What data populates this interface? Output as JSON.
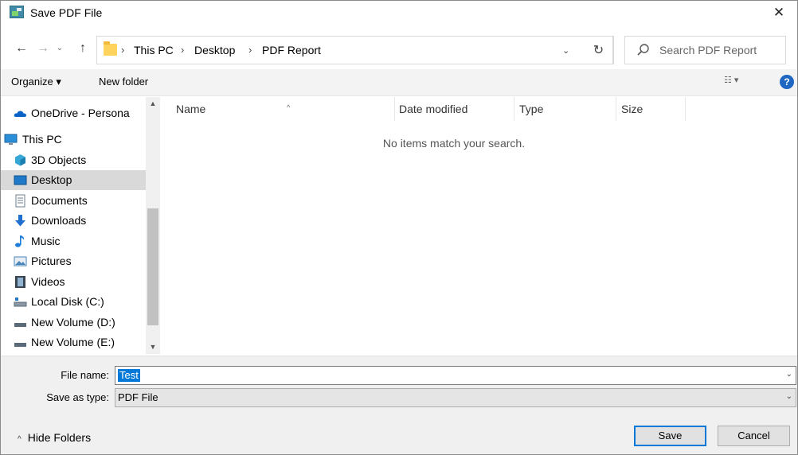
{
  "window": {
    "title": "Save PDF File",
    "close_glyph": "✕"
  },
  "nav": {
    "back_glyph": "←",
    "forward_glyph": "→",
    "recent_glyph": "⌄",
    "up_glyph": "↑"
  },
  "address": {
    "breadcrumbs": [
      "This PC",
      "Desktop",
      "PDF Report"
    ],
    "separator": "›",
    "dropdown_glyph": "⌄",
    "refresh_glyph": "↻"
  },
  "search": {
    "placeholder": "Search PDF Report"
  },
  "toolbar": {
    "organize_label": "Organize ▾",
    "new_folder_label": "New folder",
    "view_glyph": "☷ ▾",
    "help_glyph": "?"
  },
  "sidebar": {
    "items": [
      {
        "label": "OneDrive - Persona",
        "icon": "onedrive-cloud-icon",
        "color": "#0a64c8"
      },
      {
        "label": "This PC",
        "icon": "computer-icon",
        "color": "#2a8fd8"
      },
      {
        "label": "3D Objects",
        "icon": "cube-icon",
        "color": "#36a7d6"
      },
      {
        "label": "Desktop",
        "icon": "desktop-icon",
        "color": "#1e79c8"
      },
      {
        "label": "Documents",
        "icon": "document-icon",
        "color": "#6d7c8c"
      },
      {
        "label": "Downloads",
        "icon": "download-arrow-icon",
        "color": "#1e6fd0"
      },
      {
        "label": "Music",
        "icon": "music-note-icon",
        "color": "#1e7dd9"
      },
      {
        "label": "Pictures",
        "icon": "picture-icon",
        "color": "#4a86b8"
      },
      {
        "label": "Videos",
        "icon": "film-icon",
        "color": "#3a4652"
      },
      {
        "label": "Local Disk (C:)",
        "icon": "drive-icon",
        "color": "#5a6a78"
      },
      {
        "label": "New Volume (D:)",
        "icon": "drive-icon",
        "color": "#5a6a78"
      },
      {
        "label": "New Volume (E:)",
        "icon": "drive-icon",
        "color": "#5a6a78"
      }
    ],
    "selected_label": "Desktop"
  },
  "filelist": {
    "columns": [
      "Name",
      "Date modified",
      "Type",
      "Size"
    ],
    "sort_glyph": "^",
    "empty_message": "No items match your search."
  },
  "form": {
    "filename_label": "File name:",
    "filename_value": "Test",
    "savetype_label": "Save as type:",
    "savetype_value": "PDF File",
    "dropdown_glyph": "⌄"
  },
  "footer": {
    "hide_folders_label": "Hide Folders",
    "hide_folders_glyph": "^",
    "save_label": "Save",
    "cancel_label": "Cancel"
  },
  "colors": {
    "accent": "#0078d7",
    "selected_bg": "#d9d9d9"
  }
}
